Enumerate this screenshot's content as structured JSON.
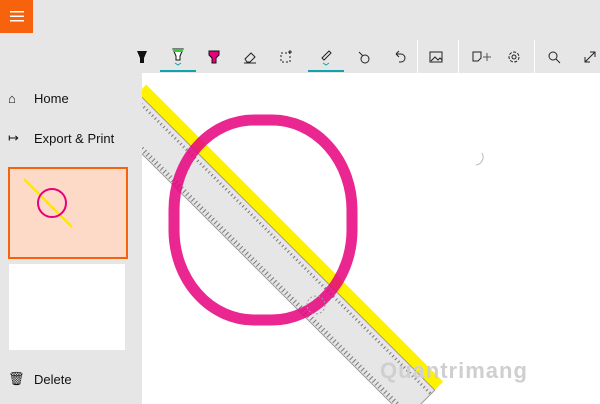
{
  "menu": {
    "icon": "hamburger-icon"
  },
  "toolbar": {
    "tools": [
      "ballpoint-pen",
      "pencil",
      "highlighter",
      "eraser",
      "selection",
      "ruler",
      "touch-writing",
      "undo",
      "add-image",
      "add-page",
      "settings",
      "zoom",
      "fullscreen"
    ]
  },
  "sidebar": {
    "home": "Home",
    "export": "Export & Print",
    "delete": "Delete"
  },
  "watermark": "Quantrimang",
  "colors": {
    "accent": "#f7630c",
    "ink": "#e6007e",
    "highlight": "#fff200",
    "active": "#0fa3b1"
  }
}
